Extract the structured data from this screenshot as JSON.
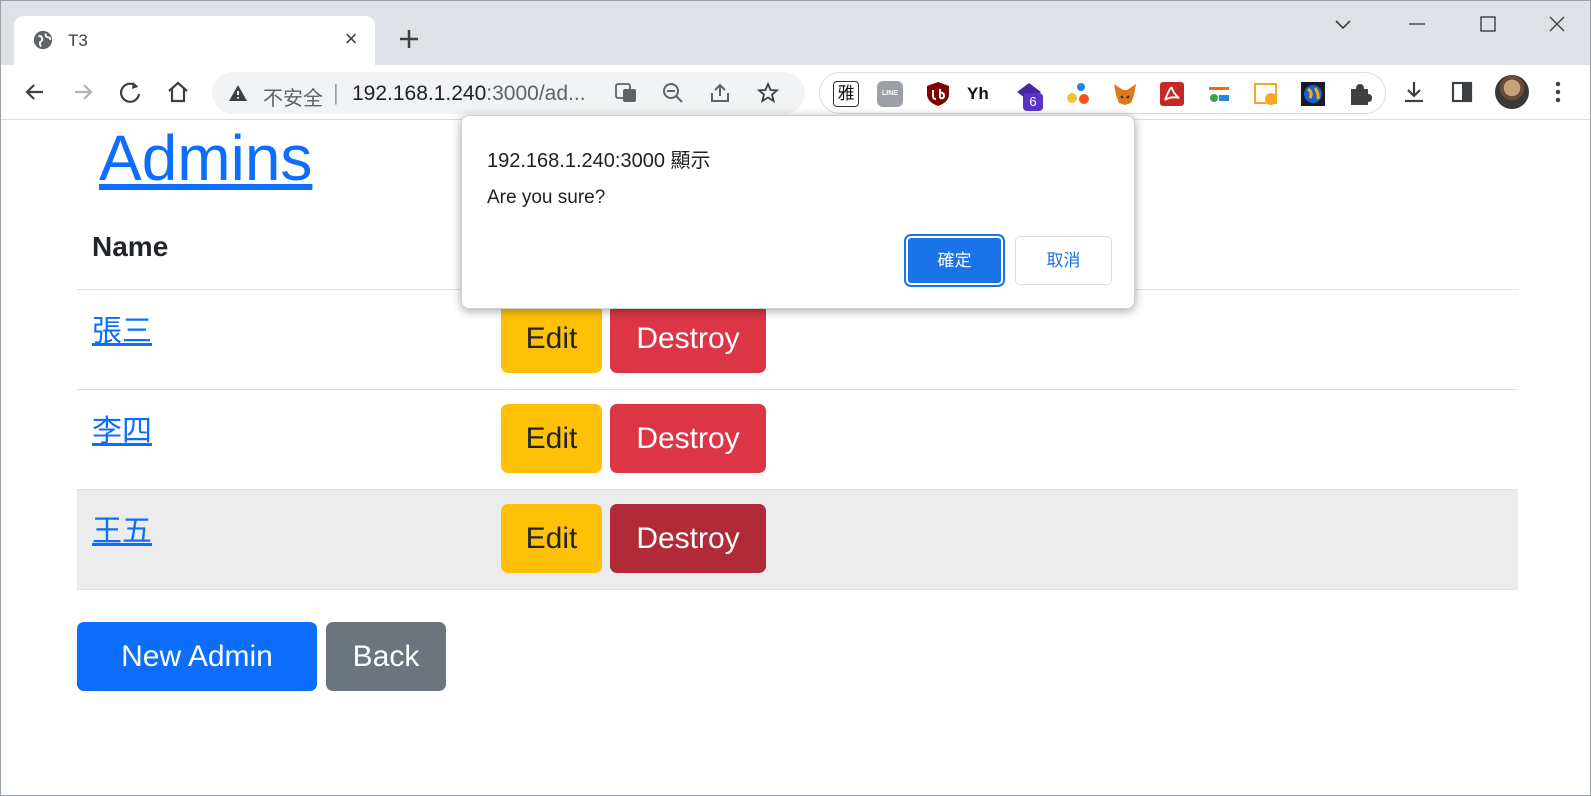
{
  "browser": {
    "tab_title": "T3",
    "omnibox": {
      "insecure_label": "不安全",
      "separator": "|",
      "url_host": "192.168.1.240",
      "url_rest": ":3000/ad..."
    },
    "extensions_badge": "6",
    "ext_ya_label": "雅",
    "ext_line_label": "LINE",
    "ext_yh_label": "Yh",
    "icons": [
      "globe-icon",
      "close-icon",
      "plus-icon",
      "chevron-down-icon",
      "minimize-icon",
      "maximize-icon",
      "window-close-icon",
      "back-icon",
      "forward-icon",
      "reload-icon",
      "home-icon",
      "warning-icon",
      "translate-icon",
      "zoom-out-icon",
      "share-icon",
      "star-icon",
      "puzzle-icon",
      "download-icon",
      "side-panel-icon",
      "avatar",
      "menu-icon"
    ]
  },
  "page": {
    "title": "Admins",
    "table": {
      "header_name": "Name",
      "rows": [
        {
          "name": "張三",
          "edit": "Edit",
          "destroy": "Destroy"
        },
        {
          "name": "李四",
          "edit": "Edit",
          "destroy": "Destroy"
        },
        {
          "name": "王五",
          "edit": "Edit",
          "destroy": "Destroy"
        }
      ]
    },
    "new_button": "New Admin",
    "back_button": "Back"
  },
  "dialog": {
    "origin": "192.168.1.240:3000 顯示",
    "message": "Are you sure?",
    "ok": "確定",
    "cancel": "取消"
  },
  "colors": {
    "primary": "#0d6efd",
    "warning": "#ffc107",
    "danger": "#dc3545",
    "danger_hover": "#b02a37",
    "secondary": "#6c757d",
    "chrome_blue": "#1a73e8"
  }
}
